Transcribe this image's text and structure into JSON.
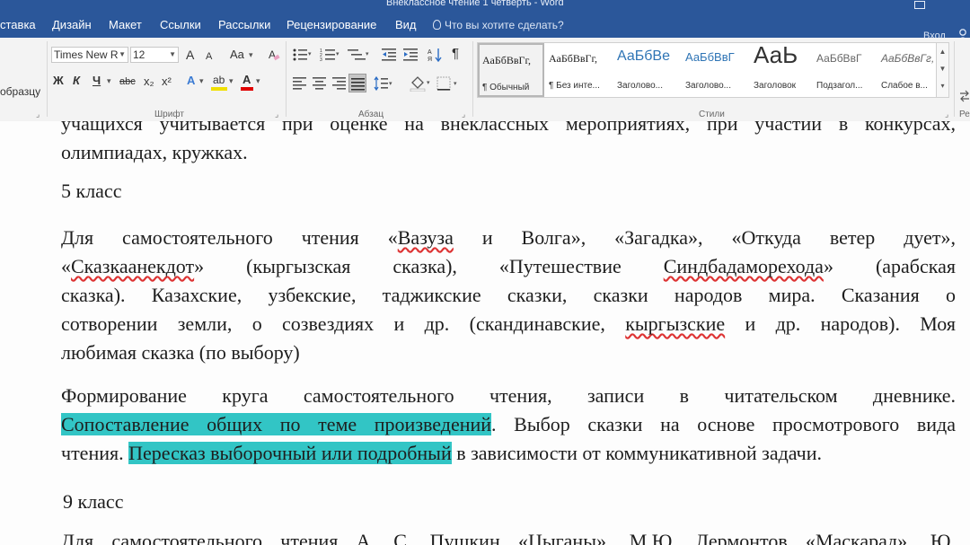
{
  "window": {
    "title": "Внеклассное чтение 1 четверть - Word"
  },
  "tabs": [
    "ставка",
    "Дизайн",
    "Макет",
    "Ссылки",
    "Рассылки",
    "Рецензирование",
    "Вид"
  ],
  "tell_me": "Что вы хотите сделать?",
  "login": "Вход",
  "ribbon": {
    "clipboard_label": "образцу",
    "font_name": "Times New R",
    "font_size": "12",
    "grow": "A",
    "shrink": "A",
    "case": "Aa",
    "bold": "Ж",
    "italic": "К",
    "underline": "Ч",
    "strike": "abc",
    "subscript": "x₂",
    "superscript": "x²",
    "text_effects": "A",
    "highlight": "ab",
    "font_color": "A",
    "font_group": "Шрифт",
    "para_group": "Абзац",
    "styles_group": "Стили",
    "edit_group": "Ре",
    "highlight_color": "#f0e000",
    "font_color_value": "#e00000",
    "styles": [
      {
        "preview": "АаБбВвГг,",
        "name": "¶ Обычный"
      },
      {
        "preview": "АаБбВвГг,",
        "name": "¶ Без инте..."
      },
      {
        "preview": "АаБбВе",
        "name": "Заголово..."
      },
      {
        "preview": "АаБбВвГ",
        "name": "Заголово..."
      },
      {
        "preview": "АаЬ",
        "name": "Заголовок"
      },
      {
        "preview": "АаБбВвГ",
        "name": "Подзагол..."
      },
      {
        "preview": "АаБбВвГг,",
        "name": "Слабое в..."
      }
    ]
  },
  "document": {
    "lines_top": {
      "l1": "учащихся учитывается при оценке на внеклассных мероприятиях, при участии в конкурсах,",
      "l2": "олимпиадах, кружках."
    },
    "heading5": "5 класс",
    "p1": {
      "l1a": "Для самостоятельного чтения «",
      "l1b": "Вазуза",
      "l1c": " и Волга», «Загадка», «Откуда ветер дует»,",
      "l2a": "«",
      "l2b": "Сказкаанекдот",
      "l2c": "» (кыргызская сказка), «Путешествие ",
      "l2d": "Синдбадаморехода",
      "l2e": "» (арабская",
      "l3": "сказка). Казахские, узбекские, таджикские сказки, сказки народов мира. Сказания о",
      "l4a": "сотворении земли, о созвездиях и др. (скандинавские, ",
      "l4b": "кыргызские",
      "l4c": " и др. народов). Моя",
      "l5": "любимая сказка (по выбору)"
    },
    "p2": {
      "l1": "Формирование круга самостоятельного чтения, записи в читательском дневнике.",
      "l2a": "Сопоставление общих по теме произведений",
      "l2b": ". Выбор сказки на основе просмотрового вида",
      "l3a": "чтения. ",
      "l3b": "Пересказ выборочный или подробный",
      "l3c": " в зависимости от коммуникативной задачи."
    },
    "heading9": "9 класс",
    "p3_partial": "Для самостоятельного чтения А. С. Пушкин «Цыганы», М.Ю. Лермонтов «Маскарад», Ю.",
    "highlight_color": "#32c5c5"
  }
}
